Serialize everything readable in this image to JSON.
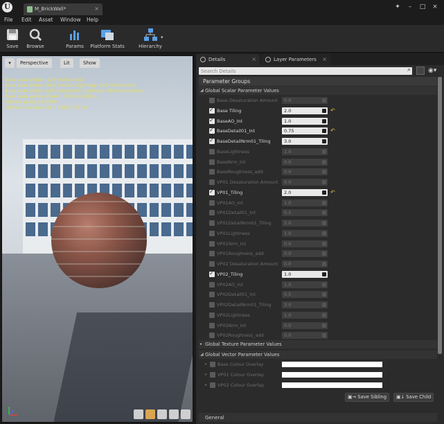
{
  "window": {
    "tab_title": "M_BrickWall*"
  },
  "menu": [
    "File",
    "Edit",
    "Asset",
    "Window",
    "Help"
  ],
  "toolbar": {
    "save": "Save",
    "browse": "Browse",
    "params": "Params",
    "platform_stats": "Platform Stats",
    "hierarchy": "Hierarchy"
  },
  "viewport": {
    "perspective": "Perspective",
    "lit": "Lit",
    "show": "Show",
    "stats": [
      "Base pass shader: 228 instructions",
      "Base pass shader with Surface Lightmap: 262 instructions",
      "Base pass shader with Volumetric Lightmap: 260 instructions",
      "Base pass vertex shader: 79 instructions",
      "Texture samplers: 6/16",
      "Texture Lookups (Est.): VS(2), PS(14)"
    ]
  },
  "panel": {
    "tab_details": "Details",
    "tab_layer_params": "Layer Parameters",
    "search_placeholder": "Search Details",
    "parameter_groups": "Parameter Groups",
    "scalar_section": "Global Scalar Parameter Values",
    "texture_section": "Global Texture Parameter Values",
    "vector_section": "Global Vector Parameter Values",
    "general": "General",
    "save_sibling": "Save Sibling",
    "save_child": "Save Child",
    "scalars": [
      {
        "name": "Base Desaturation Amount",
        "value": "0.0",
        "enabled": false
      },
      {
        "name": "Base Tiling",
        "value": "2.0",
        "enabled": true
      },
      {
        "name": "BaseAO_Int",
        "value": "1.0",
        "enabled": true
      },
      {
        "name": "BaseDetail01_Int",
        "value": "0.75",
        "enabled": true
      },
      {
        "name": "BaseDetailNrm01_Tiling",
        "value": "3.0",
        "enabled": true
      },
      {
        "name": "BaseLightness",
        "value": "1.0",
        "enabled": false
      },
      {
        "name": "BaseNrm_Int",
        "value": "0.0",
        "enabled": false
      },
      {
        "name": "BaseRoughness_add",
        "value": "0.0",
        "enabled": false
      },
      {
        "name": "VP01 Desaturation Amount",
        "value": "0.0",
        "enabled": false
      },
      {
        "name": "VP01_Tiling",
        "value": "2.0",
        "enabled": true
      },
      {
        "name": "VP01AO_Int",
        "value": "1.0",
        "enabled": false
      },
      {
        "name": "VP01Detail01_Int",
        "value": "0.5",
        "enabled": false
      },
      {
        "name": "VP01DetailNrm01_Tiling",
        "value": "3.0",
        "enabled": false
      },
      {
        "name": "VP01Lightness",
        "value": "1.0",
        "enabled": false
      },
      {
        "name": "VP01Nrm_Int",
        "value": "0.0",
        "enabled": false
      },
      {
        "name": "VP01Roughness_add",
        "value": "0.0",
        "enabled": false
      },
      {
        "name": "VP02 Desaturation Amount",
        "value": "0.0",
        "enabled": false
      },
      {
        "name": "VP02_Tiling",
        "value": "1.0",
        "enabled": true
      },
      {
        "name": "VP02AO_Int",
        "value": "1.0",
        "enabled": false
      },
      {
        "name": "VP02Detail01_Int",
        "value": "0.5",
        "enabled": false
      },
      {
        "name": "VP02DetailNrm01_Tiling",
        "value": "3.0",
        "enabled": false
      },
      {
        "name": "VP02Lightness",
        "value": "1.0",
        "enabled": false
      },
      {
        "name": "VP02Nrm_Int",
        "value": "0.0",
        "enabled": false
      },
      {
        "name": "VP02Roughness_add",
        "value": "0.0",
        "enabled": false
      }
    ],
    "vectors": [
      {
        "name": "Base Colour Overlay",
        "color": "#ffffff"
      },
      {
        "name": "VP01 Colour Overlay",
        "color": "#ffffff"
      },
      {
        "name": "VP02 Colour Overlay",
        "color": "#ffffff"
      }
    ],
    "reset_icon": "reset-arrow-icon",
    "accent_color": "#d9c34a"
  }
}
